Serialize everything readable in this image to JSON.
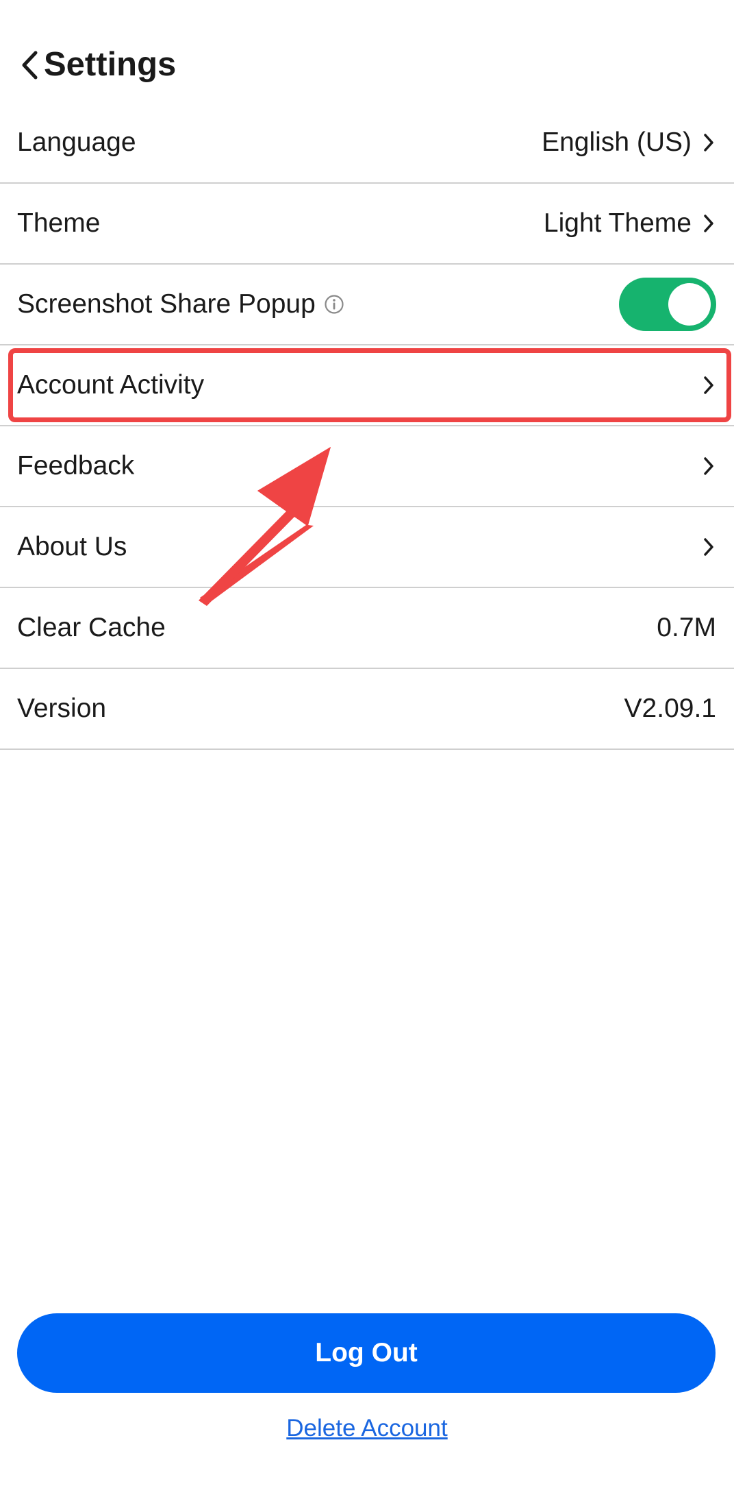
{
  "header": {
    "title": "Settings",
    "back_icon": "chevron-left-icon"
  },
  "settings": {
    "language": {
      "label": "Language",
      "value": "English (US)"
    },
    "theme": {
      "label": "Theme",
      "value": "Light Theme"
    },
    "screenshot_share": {
      "label": "Screenshot Share Popup",
      "enabled": true
    },
    "account_activity": {
      "label": "Account Activity"
    },
    "feedback": {
      "label": "Feedback"
    },
    "about_us": {
      "label": "About Us"
    },
    "clear_cache": {
      "label": "Clear Cache",
      "value": "0.7M"
    },
    "version": {
      "label": "Version",
      "value": "V2.09.1"
    }
  },
  "footer": {
    "logout_label": "Log Out",
    "delete_label": "Delete Account"
  },
  "colors": {
    "toggle_on": "#16b36e",
    "primary_button": "#0066f5",
    "link": "#1a66e0",
    "annotation": "#ef4444"
  }
}
